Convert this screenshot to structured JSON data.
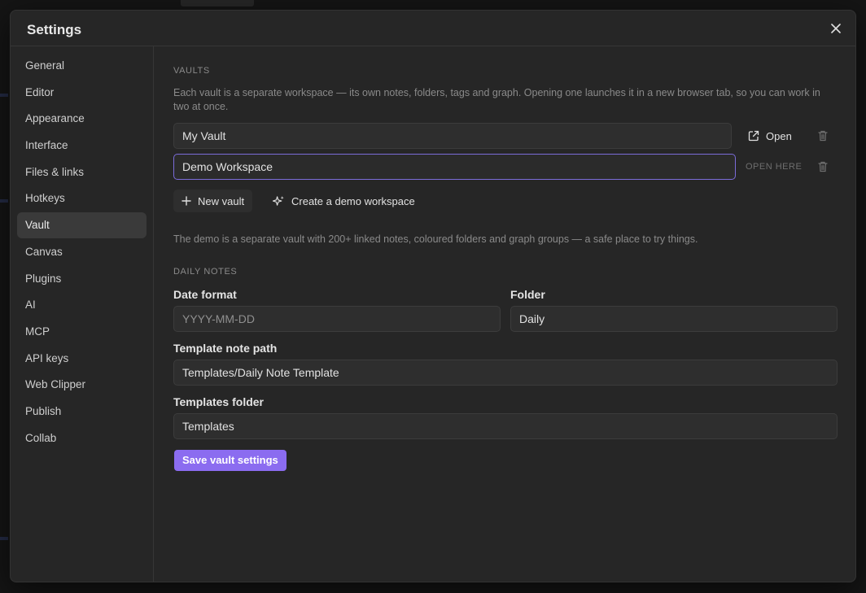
{
  "modal": {
    "title": "Settings"
  },
  "sidebar": {
    "items": [
      {
        "label": "General"
      },
      {
        "label": "Editor"
      },
      {
        "label": "Appearance"
      },
      {
        "label": "Interface"
      },
      {
        "label": "Files & links"
      },
      {
        "label": "Hotkeys"
      },
      {
        "label": "Vault",
        "active": true
      },
      {
        "label": "Canvas"
      },
      {
        "label": "Plugins"
      },
      {
        "label": "AI"
      },
      {
        "label": "MCP"
      },
      {
        "label": "API keys"
      },
      {
        "label": "Web Clipper"
      },
      {
        "label": "Publish"
      },
      {
        "label": "Collab"
      }
    ]
  },
  "vaults": {
    "heading": "VAULTS",
    "description": "Each vault is a separate workspace — its own notes, folders, tags and graph. Opening one launches it in a new browser tab, so you can work in two at once.",
    "items": [
      {
        "name": "My Vault",
        "action": "Open"
      },
      {
        "name": "Demo Workspace",
        "action": "OPEN HERE"
      }
    ],
    "new_vault_label": "New vault",
    "demo_label": "Create a demo workspace",
    "demo_note": "The demo is a separate vault with 200+ linked notes, coloured folders and graph groups — a safe place to try things."
  },
  "daily_notes": {
    "heading": "DAILY NOTES",
    "date_format_label": "Date format",
    "date_format_placeholder": "YYYY-MM-DD",
    "folder_label": "Folder",
    "folder_value": "Daily",
    "template_path_label": "Template note path",
    "template_path_value": "Templates/Daily Note Template",
    "templates_folder_label": "Templates folder",
    "templates_folder_value": "Templates"
  },
  "save_label": "Save vault settings",
  "colors": {
    "accent": "#8b6cf0",
    "focus_border": "#7b6cd9",
    "background": "#262626"
  }
}
